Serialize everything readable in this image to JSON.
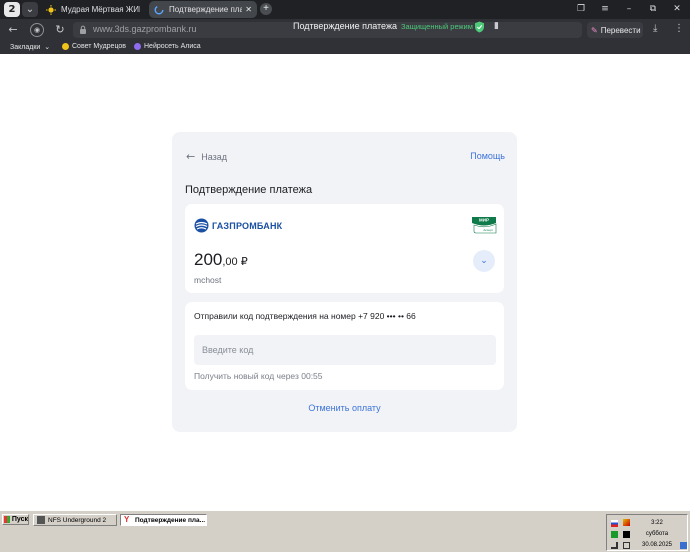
{
  "browser": {
    "tabs": [
      {
        "title": "Мудрая Мёртвая ЖИВА |",
        "active": false
      },
      {
        "title": "Подтверждение плате",
        "active": true
      }
    ],
    "new_tab_icon": "plus-icon",
    "url": "www.3ds.gazprombank.ru",
    "page_title": "Подтверждение платежа",
    "secure_mode": "Защищенный режим",
    "translate_label": "Перевести",
    "bookmarks": {
      "menu_label": "Закладки",
      "items": [
        "Совет Мудрецов",
        "Нейросеть Алиса"
      ]
    },
    "colors": {
      "chrome": "#1f2124",
      "bar": "#2f3136",
      "secure": "#4dc97a"
    }
  },
  "payment": {
    "back_label": "Назад",
    "help_label": "Помощь",
    "title": "Подтверждение платежа",
    "bank_name": "ГАЗПРОМБАНК",
    "card_network": "МИР",
    "card_network_sub": "Accept",
    "amount_int": "200",
    "amount_frac": ",00 ₽",
    "merchant": "mchost",
    "sent_message": "Отправили код подтверждения на номер +7 920 ••• •• 66",
    "code_placeholder": "Введите код",
    "code_value": "",
    "resend_text": "Получить новый код через 00:55",
    "cancel_label": "Отменить оплату",
    "colors": {
      "accent": "#3d73d9",
      "bank": "#1a4fa3",
      "mir": "#0f7a4a"
    }
  },
  "taskbar": {
    "start_label": "Пуск",
    "tasks": [
      {
        "title": "NFS Underground 2",
        "active": false
      },
      {
        "title": "Подтверждение пла...",
        "active": true
      }
    ],
    "clock": {
      "time": "3:22",
      "day": "суббота",
      "date": "30.08.2025"
    }
  }
}
